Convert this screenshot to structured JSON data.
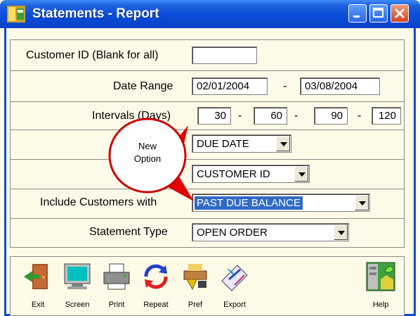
{
  "window": {
    "title": "Statements - Report"
  },
  "form": {
    "customer_id": {
      "label": "Customer ID (Blank for all)",
      "value": ""
    },
    "date_range": {
      "label": "Date Range",
      "from": "02/01/2004",
      "to": "03/08/2004"
    },
    "intervals": {
      "label": "Intervals (Days)",
      "values": [
        "30",
        "60",
        "90",
        "120"
      ]
    },
    "sort_primary": {
      "value": "DUE DATE"
    },
    "sort_secondary": {
      "value": "CUSTOMER ID"
    },
    "include_customers": {
      "label": "Include Customers with",
      "value": "PAST DUE BALANCE"
    },
    "statement_type": {
      "label": "Statement Type",
      "value": "OPEN ORDER"
    },
    "separator": "-"
  },
  "callout": {
    "line1": "New",
    "line2": "Option"
  },
  "toolbar": {
    "items": [
      {
        "label": "Exit",
        "icon": "exit-door-icon"
      },
      {
        "label": "Screen",
        "icon": "monitor-icon"
      },
      {
        "label": "Print",
        "icon": "printer-icon"
      },
      {
        "label": "Repeat",
        "icon": "repeat-arrows-icon"
      },
      {
        "label": "Pref",
        "icon": "preferences-icon"
      },
      {
        "label": "Export",
        "icon": "export-icon"
      },
      {
        "label": "Help",
        "icon": "help-icon"
      }
    ]
  },
  "colors": {
    "titlebar": "#0a4bd8",
    "selection": "#316ac5",
    "callout_arrow": "#e00000"
  }
}
